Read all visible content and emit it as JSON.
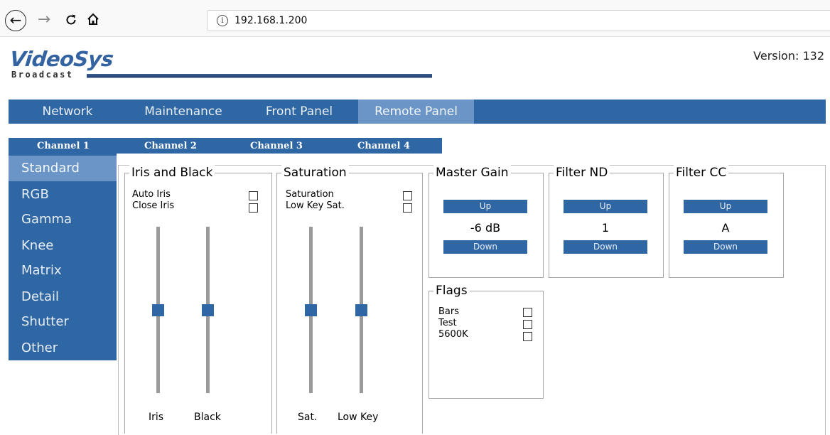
{
  "browser": {
    "url": "192.168.1.200",
    "back_glyph": "←",
    "forward_glyph": "→",
    "reload_glyph": "C",
    "home_glyph": "⌂",
    "info_glyph": "i"
  },
  "header": {
    "logo_main": "VideoSys",
    "logo_sub": "Broadcast",
    "version": "Version: 132"
  },
  "main_nav": {
    "tabs": [
      {
        "label": "Network"
      },
      {
        "label": "Maintenance"
      },
      {
        "label": "Front Panel"
      },
      {
        "label": "Remote Panel",
        "active": true
      }
    ]
  },
  "channel_nav": {
    "tabs": [
      {
        "label": "Channel 1"
      },
      {
        "label": "Channel 2"
      },
      {
        "label": "Channel 3"
      },
      {
        "label": "Channel 4"
      }
    ]
  },
  "side_menu": {
    "items": [
      {
        "label": "Standard",
        "active": true
      },
      {
        "label": "RGB"
      },
      {
        "label": "Gamma"
      },
      {
        "label": "Knee"
      },
      {
        "label": "Matrix"
      },
      {
        "label": "Detail"
      },
      {
        "label": "Shutter"
      },
      {
        "label": "Other"
      }
    ]
  },
  "iris_black": {
    "title": "Iris and Black",
    "options": [
      {
        "label": "Auto Iris",
        "checked": false
      },
      {
        "label": "Close Iris",
        "checked": false
      }
    ],
    "sliders": [
      {
        "label": "Iris",
        "level": 0.5
      },
      {
        "label": "Black",
        "level": 0.5
      }
    ]
  },
  "saturation": {
    "title": "Saturation",
    "options": [
      {
        "label": "Saturation",
        "checked": false
      },
      {
        "label": "Low Key Sat.",
        "checked": false
      }
    ],
    "sliders": [
      {
        "label": "Sat.",
        "level": 0.5
      },
      {
        "label": "Low Key",
        "level": 0.5
      }
    ]
  },
  "master_gain": {
    "title": "Master Gain",
    "up": "Up",
    "value": "-6 dB",
    "down": "Down"
  },
  "filter_nd": {
    "title": "Filter ND",
    "up": "Up",
    "value": "1",
    "down": "Down"
  },
  "filter_cc": {
    "title": "Filter CC",
    "up": "Up",
    "value": "A",
    "down": "Down"
  },
  "flags": {
    "title": "Flags",
    "items": [
      {
        "label": "Bars",
        "checked": false
      },
      {
        "label": "Test",
        "checked": false
      },
      {
        "label": "5600K",
        "checked": false
      }
    ]
  },
  "colors": {
    "accent": "#2f66a4",
    "accent_active": "#6a95c6"
  }
}
